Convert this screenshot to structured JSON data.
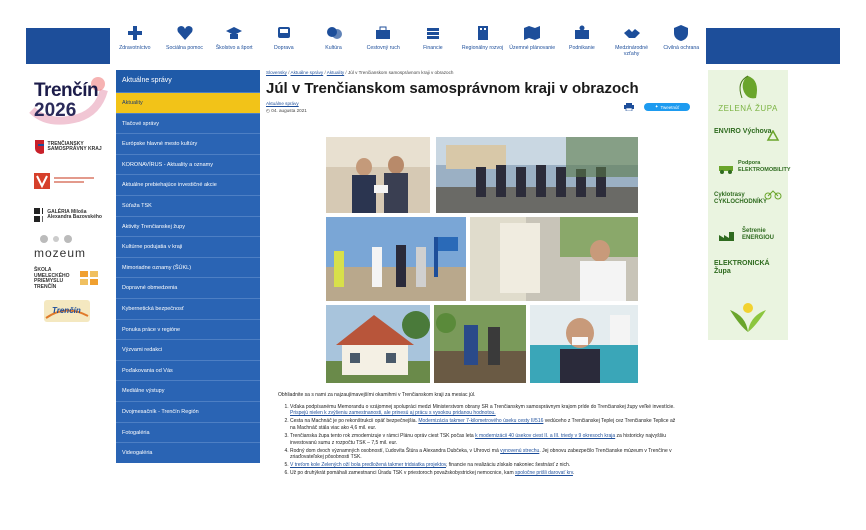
{
  "nav": {
    "items": [
      {
        "label": "Zdravotníctvo",
        "icon": "cross-icon"
      },
      {
        "label": "Sociálna pomoc",
        "icon": "heart-icon"
      },
      {
        "label": "Školstvo a šport",
        "icon": "graduation-cap-icon"
      },
      {
        "label": "Doprava",
        "icon": "bus-icon"
      },
      {
        "label": "Kultúra",
        "icon": "theater-icon"
      },
      {
        "label": "Cestovný ruch",
        "icon": "bag-icon"
      },
      {
        "label": "Financie",
        "icon": "coins-icon"
      },
      {
        "label": "Regionálny rozvoj",
        "icon": "building-icon"
      },
      {
        "label": "Územné plánovanie",
        "icon": "map-icon"
      },
      {
        "label": "Podnikanie",
        "icon": "briefcase-icon"
      },
      {
        "label": "Medzinárodné vzťahy",
        "icon": "handshake-icon"
      },
      {
        "label": "Civilná ochrana",
        "icon": "shield-icon"
      }
    ]
  },
  "logos": {
    "trencin_line1": "Trenčín",
    "trencin_line2": "2026",
    "tsk": "TRENČIANSKY SAMOSPRÁVNY KRAJ",
    "galeria": "GALÉRIA Miloša Alexandra Bazovského",
    "mozeum": "mozeum",
    "skola": "ŠKOLA UMELECKÉHO PRIEMYSLU TRENČÍN",
    "trencin_small": "Trenčín"
  },
  "sidebar": {
    "heading": "Aktuálne správy",
    "items": [
      {
        "label": "Aktuality",
        "active": true
      },
      {
        "label": "Tlačové správy"
      },
      {
        "label": "Európske hlavné mesto kultúry"
      },
      {
        "label": "KORONAVÍRUS - Aktuality a oznamy"
      },
      {
        "label": "Aktuálne prebiehajúce investičné akcie"
      },
      {
        "label": "Súťaža TSK"
      },
      {
        "label": "Aktivity Trenčianskej župy"
      },
      {
        "label": "Kultúrne podujatia v kraji"
      },
      {
        "label": "Mimoriadne oznamy (ŠÚKL)"
      },
      {
        "label": "Dopravné obmedzenia"
      },
      {
        "label": "Kybernetická bezpečnosť"
      },
      {
        "label": "Ponuka práce v regióne"
      },
      {
        "label": "Výzvami redakci"
      },
      {
        "label": "Poďakovania od Vás"
      },
      {
        "label": "Mediálne výstupy"
      },
      {
        "label": "Dvojmesačník - Trenčín Región"
      },
      {
        "label": "Fotogaléria"
      },
      {
        "label": "Videogaléria"
      }
    ]
  },
  "main": {
    "breadcrumb": [
      "Slovensky",
      "Aktuálne správy",
      "Aktuality",
      "Júl v Trenčianskom samosprávnom kraji v obrazoch"
    ],
    "title": "Júl v Trenčianskom samosprávnom kraji v obrazoch",
    "back_link": "Aktuálne správy",
    "date": "04. augusta 2021",
    "tweet_label": "Tweetnúť",
    "intro": "Obhliadnite sa s nami za najzaujímavejšími okamihmi v Trenčianskom kraji za mesiac júl.",
    "list": [
      {
        "text": "Vďaka podpísanému Memorandu o vzájomnej spolupráci medzi Ministerstvom obrany SR a Trenčianskym samosprávnym krajom príde do Trenčianskej župy veľké investície. ",
        "link": "Prispejú nielen k zvýšeniu zamestnanosti, ale prinesú aj prácu s vysokou pridanou hodnotou."
      },
      {
        "text": "Cesta na Machnáč je po rekonštrukcii opäť bezpečnejšia. ",
        "link": "Modernizácia takmer 7-kilometrového úseku cesty II/516",
        "tail": " vedúceho z Trenčianskej Teplej cez Trenčianske Teplice až na Machnáč stála viac ako 4,6 mil. eur."
      },
      {
        "text": "Trenčianska župa tento rok zmodernizuje v rámci Plánu opráv ciest TSK počas leta ",
        "link": "k modernizácii 40 úsekov ciest II. a III. triedy v 9 okresoch kraja",
        "tail": " za historicky najvyššiu investovanú sumu z rozpočtu TSK – 7,5 mil. eur."
      },
      {
        "text": "Rodný dom dvoch významných osobností, Ľudovíta Štúra a Alexandra Dubčeka, v Uhrovci má ",
        "link": "vynovenú strechu",
        "tail": ". Jej obnovu zabezpečilo Trenčianske múzeum v Trenčíne v zriaďovateľskej pôsobnosti TSK."
      },
      {
        "text": "",
        "link": "V treťom kole Zelených oží bola predložená takmer tridsiatka projektov",
        "tail": ", financie na realizáciu získalo nakoniec šestnásť z nich."
      },
      {
        "text": "Už po druhýkrát pomáhali zamestnanci Úradu TSK v priestoroch považskobystrickej nemocnice, kam ",
        "link": "spoločne prišli darovať krv",
        "tail": "."
      }
    ]
  },
  "banner": {
    "heading": "ZELENÁ ŽUPA",
    "items": [
      "ENVIRO Výchova",
      "Podpora ELEKTROMOBILITY",
      "Cyklotrasy CYKLOCHODNÍKY",
      "Šetrenie ENERGIOU",
      "ELEKTRONICKÁ Župa"
    ]
  },
  "colors": {
    "brand_blue": "#1d4e9a",
    "sidebar_blue": "#2a64b4",
    "active_yellow": "#f2c318",
    "banner_green": "#6aa52b"
  }
}
